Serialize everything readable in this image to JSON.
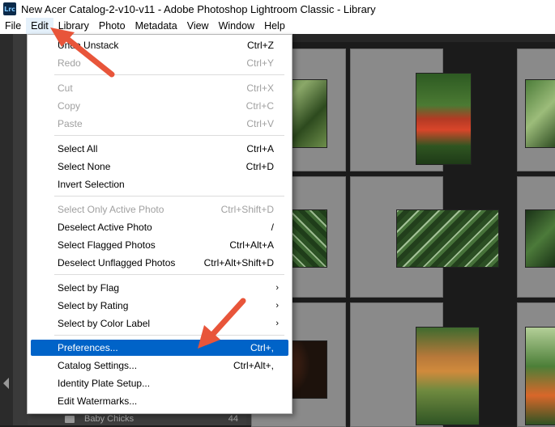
{
  "window": {
    "app_icon": "Lrc",
    "title": "New Acer Catalog-2-v10-v11 - Adobe Photoshop Lightroom Classic - Library"
  },
  "menubar": [
    {
      "label": "File"
    },
    {
      "label": "Edit"
    },
    {
      "label": "Library"
    },
    {
      "label": "Photo"
    },
    {
      "label": "Metadata"
    },
    {
      "label": "View"
    },
    {
      "label": "Window"
    },
    {
      "label": "Help"
    }
  ],
  "edit_menu": {
    "items": [
      {
        "label": "Undo Unstack",
        "shortcut": "Ctrl+Z",
        "disabled": false
      },
      {
        "label": "Redo",
        "shortcut": "Ctrl+Y",
        "disabled": true
      },
      {
        "label": "Cut",
        "shortcut": "Ctrl+X",
        "disabled": true
      },
      {
        "label": "Copy",
        "shortcut": "Ctrl+C",
        "disabled": true
      },
      {
        "label": "Paste",
        "shortcut": "Ctrl+V",
        "disabled": true
      },
      {
        "label": "Select All",
        "shortcut": "Ctrl+A",
        "disabled": false
      },
      {
        "label": "Select None",
        "shortcut": "Ctrl+D",
        "disabled": false
      },
      {
        "label": "Invert Selection",
        "shortcut": "",
        "disabled": false
      },
      {
        "label": "Select Only Active Photo",
        "shortcut": "Ctrl+Shift+D",
        "disabled": true
      },
      {
        "label": "Deselect Active Photo",
        "shortcut": "/",
        "disabled": false
      },
      {
        "label": "Select Flagged Photos",
        "shortcut": "Ctrl+Alt+A",
        "disabled": false
      },
      {
        "label": "Deselect Unflagged Photos",
        "shortcut": "Ctrl+Alt+Shift+D",
        "disabled": false
      },
      {
        "label": "Select by Flag",
        "submenu": true
      },
      {
        "label": "Select by Rating",
        "submenu": true
      },
      {
        "label": "Select by Color Label",
        "submenu": true
      },
      {
        "label": "Preferences...",
        "shortcut": "Ctrl+,",
        "highlighted": true
      },
      {
        "label": "Catalog Settings...",
        "shortcut": "Ctrl+Alt+,"
      },
      {
        "label": "Identity Plate Setup...",
        "shortcut": ""
      },
      {
        "label": "Edit Watermarks...",
        "shortcut": ""
      }
    ],
    "submenu_arrow": "›"
  },
  "library": {
    "folder_label": "Baby Chicks",
    "folder_count": "44"
  },
  "colors": {
    "highlight": "#0063c8",
    "annotation_arrow": "#e8553a"
  },
  "icons": [
    "folder-icon",
    "collapse-panel-arrow-icon",
    "submenu-arrow-icon"
  ]
}
